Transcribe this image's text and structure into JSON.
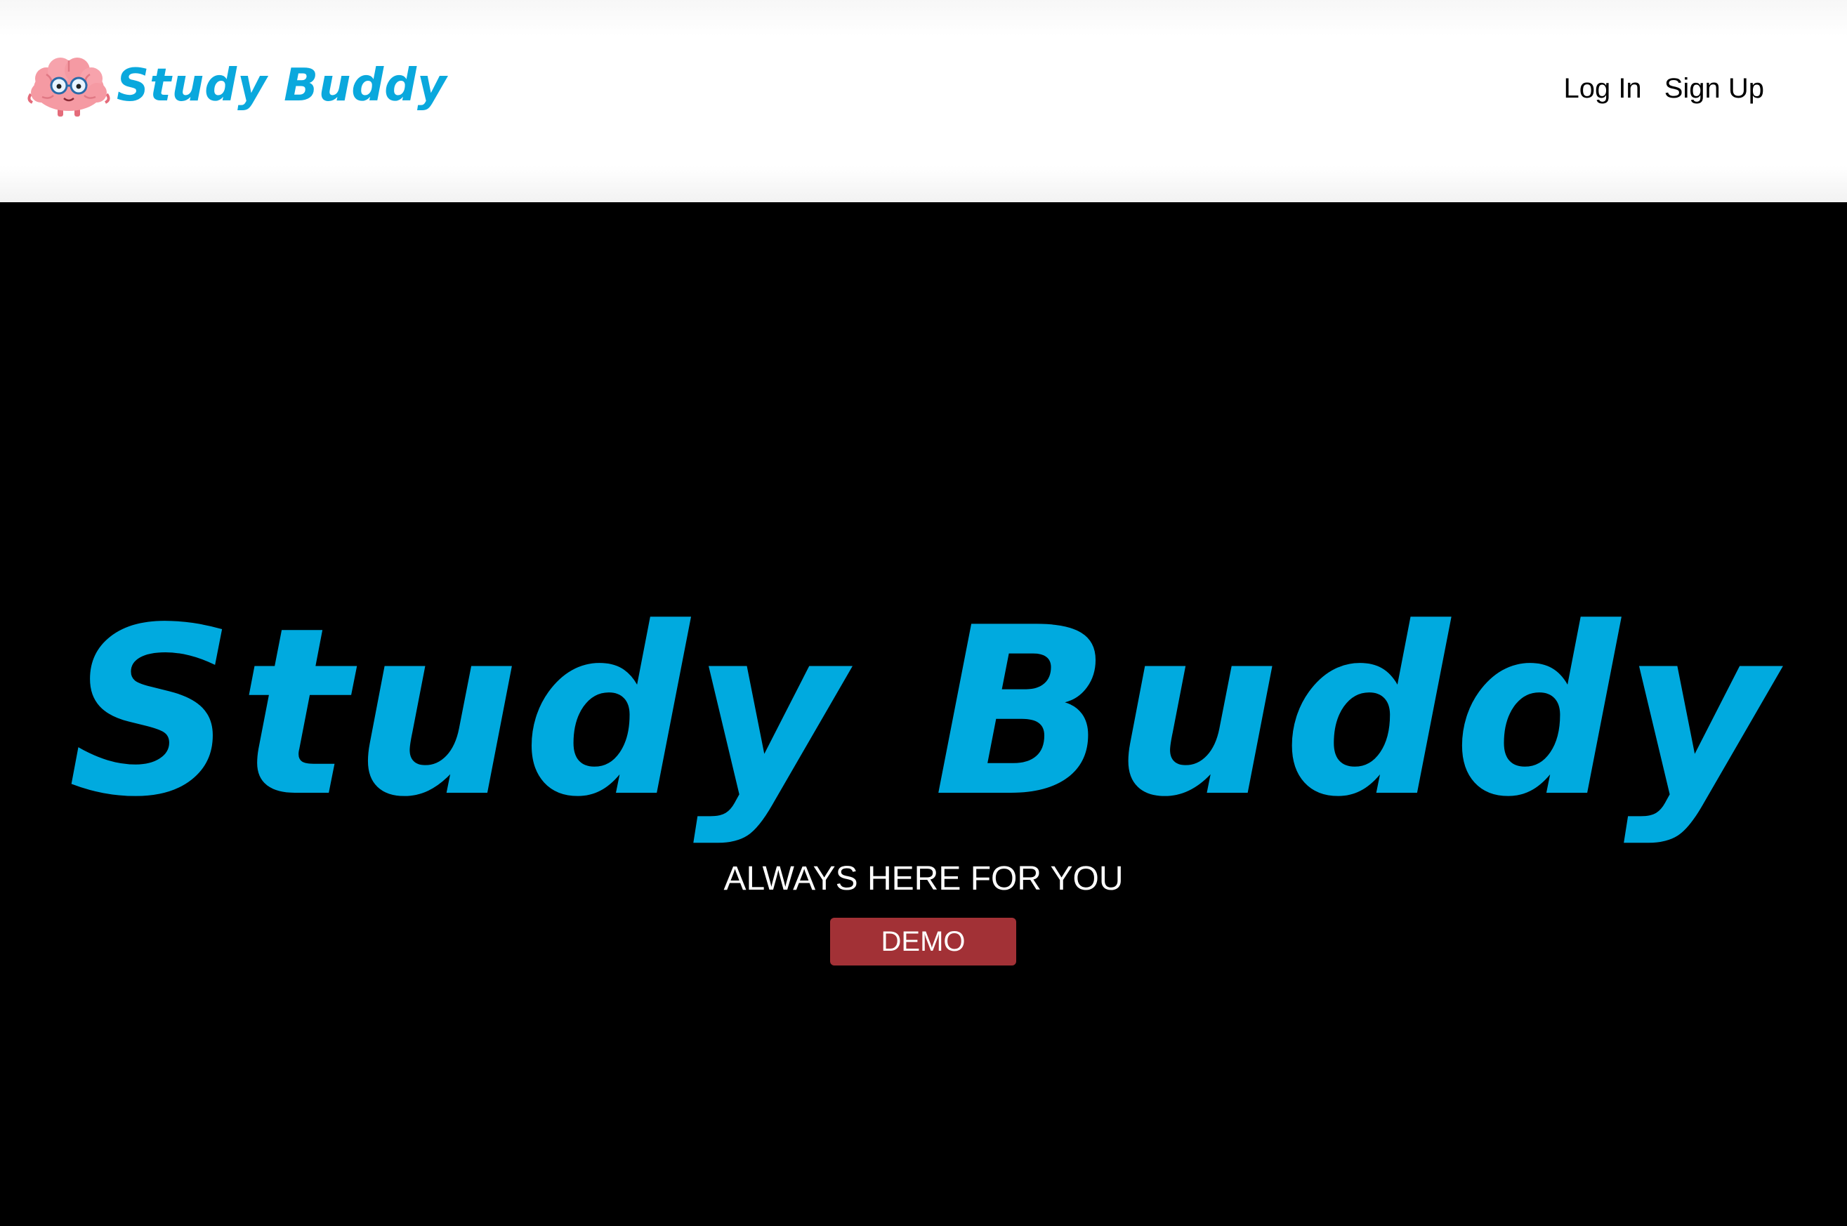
{
  "header": {
    "logo_text": "Study Buddy",
    "logo_icon": "brain-mascot-icon",
    "nav": {
      "login_label": "Log In",
      "signup_label": "Sign Up"
    }
  },
  "hero": {
    "title": "Study Buddy",
    "tagline": "ALWAYS HERE FOR YOU",
    "demo_label": "DEMO"
  },
  "colors": {
    "brand_blue": "#00aadf",
    "demo_red": "#a23136",
    "hero_background": "#000000",
    "header_background": "#ffffff"
  }
}
